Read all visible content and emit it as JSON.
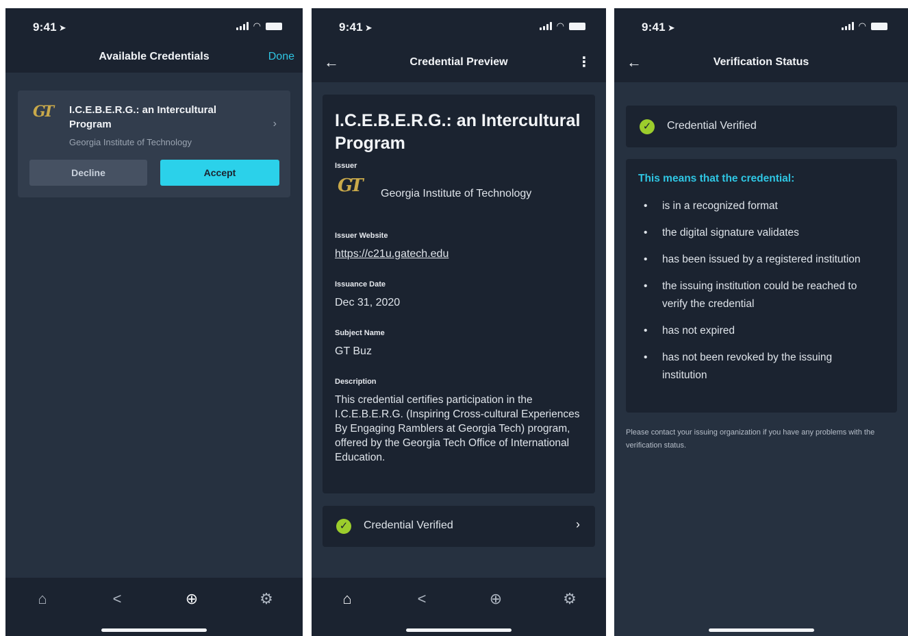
{
  "status_bar": {
    "time": "9:41",
    "location_glyph": "➤"
  },
  "screen1": {
    "title": "Available Credentials",
    "done_label": "Done",
    "offer": {
      "logo_text": "GT",
      "title": "I.C.E.B.E.R.G.: an Intercultural Program",
      "issuer": "Georgia Institute of Technology",
      "decline_label": "Decline",
      "accept_label": "Accept"
    }
  },
  "screen2": {
    "title": "Credential Preview",
    "credential_title": "I.C.E.B.E.R.G.: an Intercultural Program",
    "issuer_label": "Issuer",
    "logo_text": "GT",
    "issuer_name": "Georgia Institute of Technology",
    "website_label": "Issuer Website",
    "website": "https://c21u.gatech.edu",
    "issuance_label": "Issuance Date",
    "issuance_date": "Dec 31, 2020",
    "subject_label": "Subject Name",
    "subject_name": "GT Buz",
    "description_label": "Description",
    "description": "This credential certifies participation in the I.C.E.B.E.R.G. (Inspiring Cross-cultural Experiences By Engaging Ramblers at Georgia Tech) program, offered by the Georgia Tech Office of International Education.",
    "verified_label": "Credential Verified"
  },
  "screen3": {
    "title": "Verification Status",
    "verified_label": "Credential Verified",
    "means_heading": "This means that the credential:",
    "reasons": [
      "is in a recognized format",
      "the digital signature validates",
      "has been issued by a registered institution",
      "the issuing institution could be reached to verify the credential",
      "has not expired",
      "has not been revoked by the issuing institution"
    ],
    "footnote": "Please contact your issuing organization if you have any problems with the verification status."
  },
  "tabs": [
    {
      "name": "home",
      "icon": "home-icon",
      "glyph": "⌂"
    },
    {
      "name": "share",
      "icon": "share-icon",
      "glyph": "<"
    },
    {
      "name": "add",
      "icon": "add-circle-icon",
      "glyph": "⊕"
    },
    {
      "name": "settings",
      "icon": "gear-icon",
      "glyph": "⚙"
    }
  ],
  "colors": {
    "background": "#263140",
    "panel": "#1b2330",
    "accent": "#2bd1ea",
    "verified": "#9ccd2c",
    "gt_gold": "#c9a94a"
  }
}
